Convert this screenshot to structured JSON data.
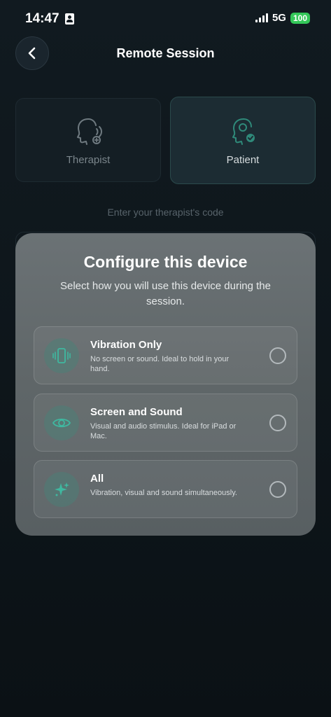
{
  "status_bar": {
    "time": "14:47",
    "network": "5G",
    "battery": "100"
  },
  "header": {
    "title": "Remote Session",
    "back_icon": "chevron-left-icon"
  },
  "roles": [
    {
      "label": "Therapist",
      "icon": "speaking-head-icon",
      "selected": false
    },
    {
      "label": "Patient",
      "icon": "head-check-icon",
      "selected": true
    }
  ],
  "code_hint": "Enter your therapist's code",
  "sheet": {
    "title": "Configure this device",
    "subtitle": "Select how you will use this device during the session.",
    "options": [
      {
        "title": "Vibration Only",
        "description": "No screen or sound. Ideal to hold in your hand.",
        "icon": "phone-vibrate-icon"
      },
      {
        "title": "Screen and Sound",
        "description": "Visual and audio stimulus. Ideal for iPad or Mac.",
        "icon": "eye-icon"
      },
      {
        "title": "All",
        "description": "Vibration, visual and sound simultaneously.",
        "icon": "sparkles-icon"
      }
    ]
  },
  "colors": {
    "accent": "#3fb8a0",
    "background": "#0f161b",
    "sheet": "#62696c",
    "battery": "#34c759"
  }
}
